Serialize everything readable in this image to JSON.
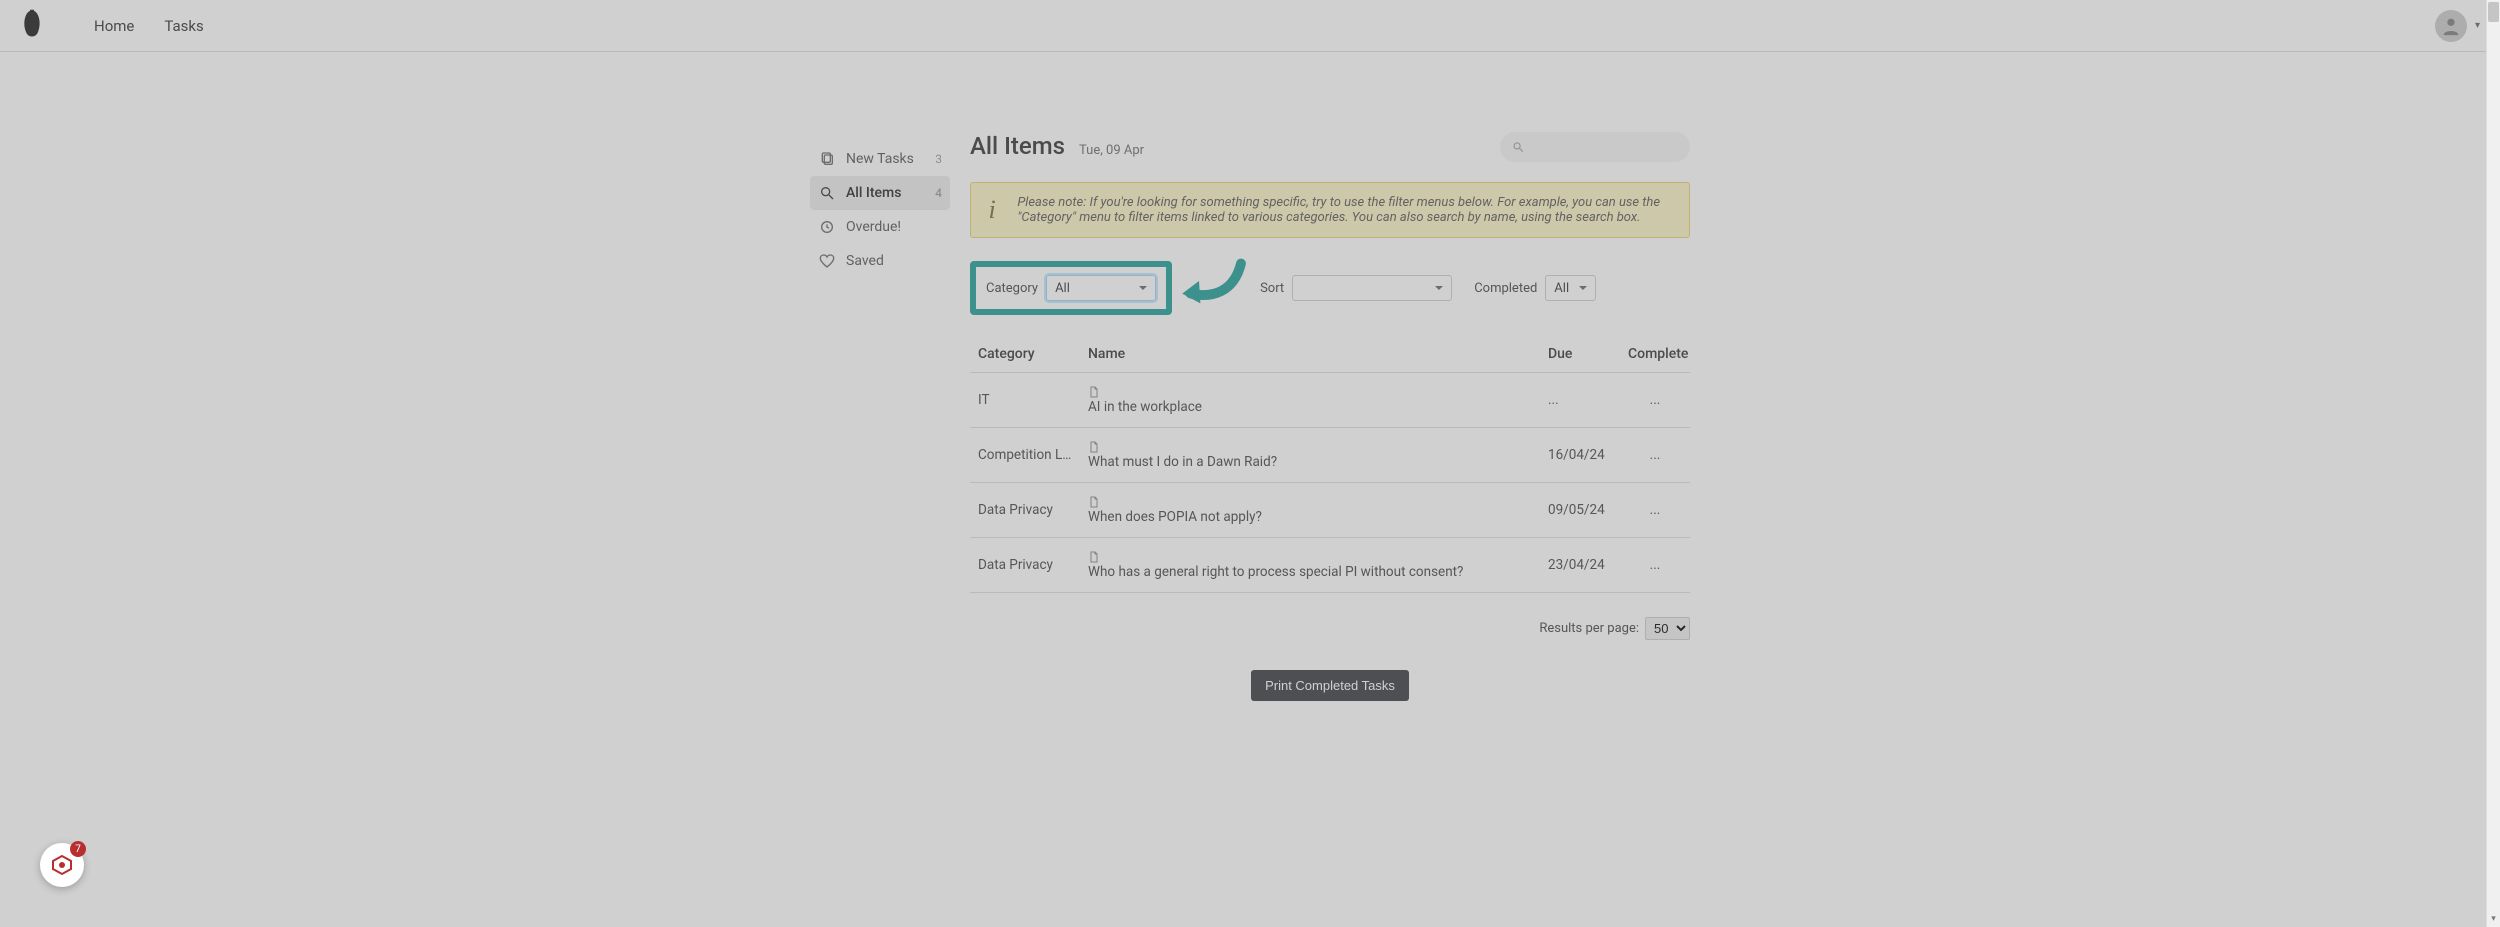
{
  "nav": {
    "home": "Home",
    "tasks": "Tasks"
  },
  "sidebar": {
    "items": [
      {
        "label": "New Tasks",
        "count": "3"
      },
      {
        "label": "All Items",
        "count": "4"
      },
      {
        "label": "Overdue!"
      },
      {
        "label": "Saved"
      }
    ]
  },
  "header": {
    "title": "All Items",
    "date": "Tue, 09 Apr"
  },
  "notice": {
    "text": "Please note: If you're looking for something specific, try to use the filter menus below. For example, you can use the \"Category\" menu to filter items linked to various categories. You can also search by name, using the search box."
  },
  "filters": {
    "category_label": "Category",
    "category_value": "All",
    "sort_label": "Sort",
    "sort_value": "",
    "completed_label": "Completed",
    "completed_value": "All"
  },
  "table": {
    "headers": {
      "category": "Category",
      "name": "Name",
      "due": "Due",
      "complete": "Complete"
    },
    "rows": [
      {
        "category": "IT",
        "name": "AI in the workplace",
        "due": "...",
        "complete": "..."
      },
      {
        "category": "Competition Law",
        "name": "What must I do in a Dawn Raid?",
        "due": "16/04/24",
        "complete": "..."
      },
      {
        "category": "Data Privacy",
        "name": "When does POPIA not apply?",
        "due": "09/05/24",
        "complete": "..."
      },
      {
        "category": "Data Privacy",
        "name": "Who has a general right to process special PI without consent?",
        "due": "23/04/24",
        "complete": "..."
      }
    ]
  },
  "pager": {
    "label": "Results per page:",
    "value": "50"
  },
  "print_button": "Print Completed Tasks",
  "widget": {
    "badge": "7"
  }
}
